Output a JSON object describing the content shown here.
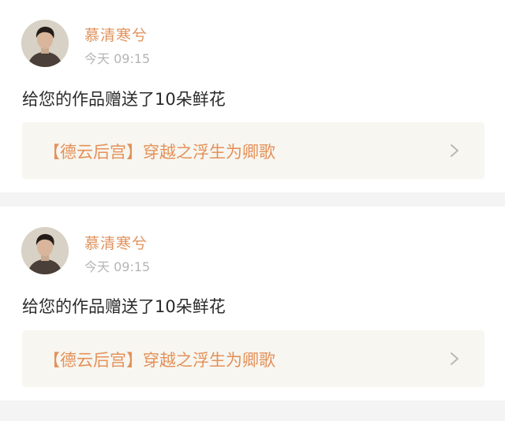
{
  "notifications": [
    {
      "username": "慕清寒兮",
      "time": "今天 09:15",
      "message": "给您的作品赠送了10朵鲜花",
      "work_title": "【德云后宫】穿越之浮生为卿歌"
    },
    {
      "username": "慕清寒兮",
      "time": "今天 09:15",
      "message": "给您的作品赠送了10朵鲜花",
      "work_title": "【德云后宫】穿越之浮生为卿歌"
    }
  ],
  "icons": {
    "avatar": "user-avatar-photo",
    "chevron": "chevron-right-icon"
  },
  "colors": {
    "accent": "#e0935d",
    "link_bg": "#f7f6f0",
    "muted": "#b5b5b5",
    "separator": "#f4f4f4"
  }
}
